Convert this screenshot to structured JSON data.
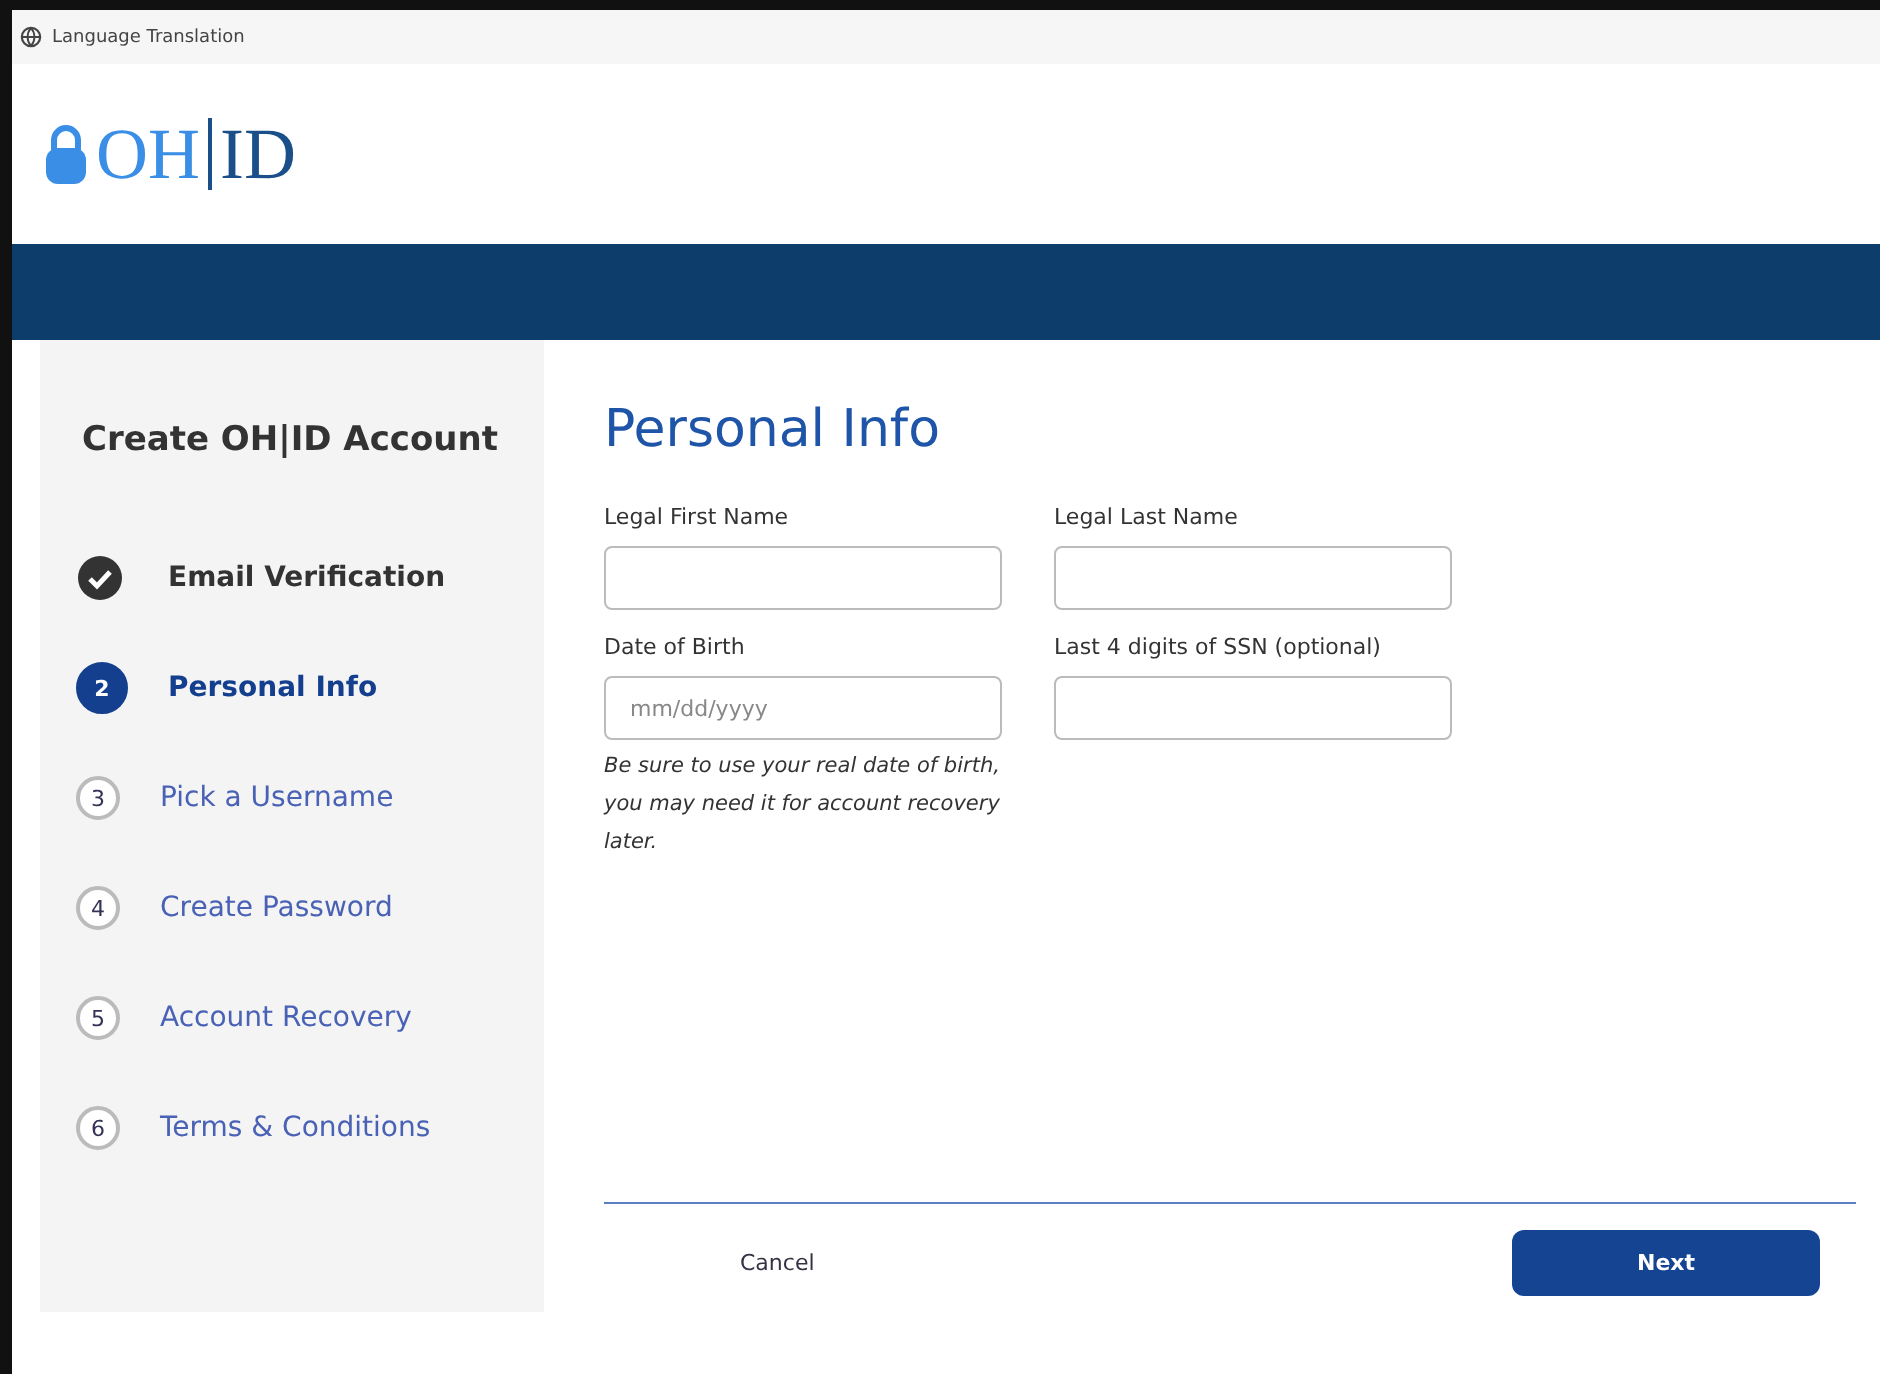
{
  "top_bar": {
    "label": "Language Translation"
  },
  "logo": {
    "part_1": "OH",
    "part_2": "ID"
  },
  "sidebar": {
    "title": "Create OH|ID Account",
    "steps": [
      {
        "label": "Email Verification",
        "completed": true,
        "selected": false
      },
      {
        "number": "2",
        "label": "Personal Info",
        "completed": false,
        "selected": true
      },
      {
        "number": "3",
        "label": "Pick a Username",
        "completed": false,
        "selected": false
      },
      {
        "number": "4",
        "label": "Create Password",
        "completed": false,
        "selected": false
      },
      {
        "number": "5",
        "label": "Account Recovery",
        "completed": false,
        "selected": false
      },
      {
        "number": "6",
        "label": "Terms & Conditions",
        "completed": false,
        "selected": false
      }
    ]
  },
  "form": {
    "title": "Personal Info",
    "fields": [
      {
        "label": "Legal First Name"
      },
      {
        "label": "Legal Last Name"
      },
      {
        "label": "Date of Birth",
        "placeholder": "mm/dd/yyyy",
        "hint": "Be sure to use your real date of birth, you may need it for account recovery later."
      },
      {
        "label": "Last 4 digits of SSN (optional)"
      }
    ]
  },
  "buttons": {
    "cancel": "Cancel",
    "next": "Next"
  }
}
